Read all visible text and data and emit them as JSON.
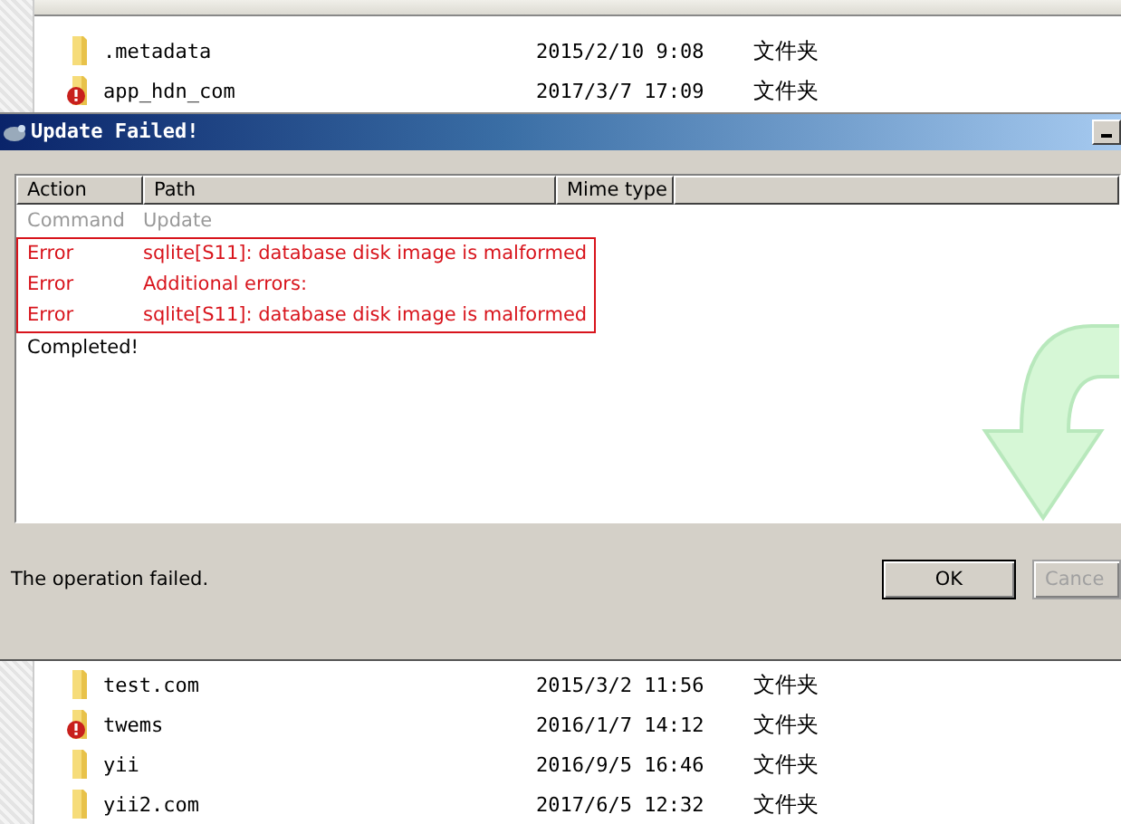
{
  "files_top": [
    {
      "name": ".metadata",
      "modified": "2015/2/10 9:08",
      "type": "文件夹",
      "warning": false
    },
    {
      "name": "app_hdn_com",
      "modified": "2017/3/7 17:09",
      "type": "文件夹",
      "warning": true
    }
  ],
  "dialog": {
    "title": "Update Failed!",
    "columns": [
      "Action",
      "Path",
      "Mime type"
    ],
    "log": [
      {
        "kind": "command",
        "action": "Command",
        "path": "Update",
        "highlighted": false
      },
      {
        "kind": "error",
        "action": "Error",
        "path": "sqlite[S11]: database disk image is malformed",
        "highlighted": true
      },
      {
        "kind": "error",
        "action": "Error",
        "path": "Additional errors:",
        "highlighted": true
      },
      {
        "kind": "error",
        "action": "Error",
        "path": "sqlite[S11]: database disk image is malformed",
        "highlighted": true
      },
      {
        "kind": "info",
        "action": "Completed!",
        "highlighted": false
      }
    ],
    "status": "The operation failed.",
    "buttons": [
      {
        "label": "OK",
        "disabled": false
      },
      {
        "label": "Cance",
        "disabled": true
      }
    ]
  },
  "files_bottom": [
    {
      "name": "test.com",
      "modified": "2015/3/2 11:56",
      "type": "文件夹",
      "warning": false
    },
    {
      "name": "twems",
      "modified": "2016/1/7 14:12",
      "type": "文件夹",
      "warning": true
    },
    {
      "name": "yii",
      "modified": "2016/9/5 16:46",
      "type": "文件夹",
      "warning": false
    },
    {
      "name": "yii2.com",
      "modified": "2017/6/5 12:32",
      "type": "文件夹",
      "warning": false
    }
  ]
}
